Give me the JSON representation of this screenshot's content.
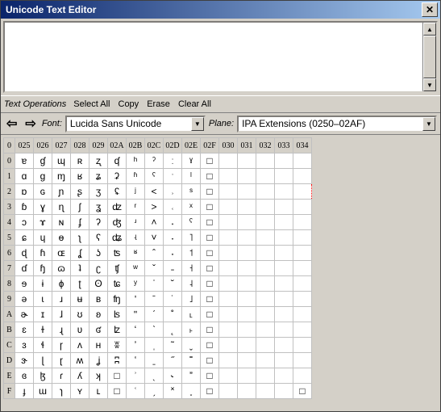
{
  "window": {
    "title": "Unicode Text Editor"
  },
  "ops": {
    "label": "Text Operations",
    "select_all": "Select All",
    "copy": "Copy",
    "erase": "Erase",
    "clear_all": "Clear All"
  },
  "nav": {
    "prev_glyph": "⇦",
    "next_glyph": "⇨",
    "font_label": "Font:",
    "font_value": "Lucida Sans Unicode",
    "plane_label": "Plane:",
    "plane_value": "IPA Extensions (0250–02AF)"
  },
  "grid": {
    "col_headers": [
      "025",
      "026",
      "027",
      "028",
      "029",
      "02A",
      "02B",
      "02C",
      "02D",
      "02E",
      "02F",
      "030",
      "031",
      "032",
      "033",
      "034"
    ],
    "row_headers": [
      "0",
      "1",
      "2",
      "3",
      "4",
      "5",
      "6",
      "7",
      "8",
      "9",
      "A",
      "B",
      "C",
      "D",
      "E",
      "F"
    ],
    "selected": {
      "row": 2,
      "col": 15
    },
    "rows": [
      [
        "ɐ",
        "ɠ",
        "ɰ",
        "ʀ",
        "ʐ",
        "ʠ",
        "ʰ",
        "ˀ",
        "ː",
        "ˠ",
        "□",
        "",
        "",
        "",
        "",
        ""
      ],
      [
        "ɑ",
        "ɡ",
        "ɱ",
        "ʁ",
        "ʑ",
        "ʡ",
        "ʱ",
        "ˁ",
        "ˑ",
        "ˡ",
        "□",
        "",
        "",
        "",
        "",
        ""
      ],
      [
        "ɒ",
        "ɢ",
        "ɲ",
        "ʂ",
        "ʒ",
        "ʢ",
        "ʲ",
        "˂",
        "˒",
        "ˢ",
        "□",
        "",
        "",
        "",
        "",
        ""
      ],
      [
        "ɓ",
        "ɣ",
        "ɳ",
        "ʃ",
        "ʓ",
        "ʣ",
        "ʳ",
        "˃",
        "˓",
        "ˣ",
        "□",
        "",
        "",
        "",
        "",
        ""
      ],
      [
        "ɔ",
        "ɤ",
        "ɴ",
        "ʄ",
        "ʔ",
        "ʤ",
        "ʴ",
        "˄",
        "˔",
        "ˤ",
        "□",
        "",
        "",
        "",
        "",
        ""
      ],
      [
        "ɕ",
        "ɥ",
        "ɵ",
        "ʅ",
        "ʕ",
        "ʥ",
        "ʵ",
        "˅",
        "˕",
        "˥",
        "□",
        "",
        "",
        "",
        "",
        ""
      ],
      [
        "ɖ",
        "ɦ",
        "ɶ",
        "ʆ",
        "ʖ",
        "ʦ",
        "ʶ",
        "ˆ",
        "˖",
        "˦",
        "□",
        "",
        "",
        "",
        "",
        ""
      ],
      [
        "ɗ",
        "ɧ",
        "ɷ",
        "ʇ",
        "ʗ",
        "ʧ",
        "ʷ",
        "ˇ",
        "˗",
        "˧",
        "□",
        "",
        "",
        "",
        "",
        ""
      ],
      [
        "ɘ",
        "ɨ",
        "ɸ",
        "ʈ",
        "ʘ",
        "ʨ",
        "ʸ",
        "ˈ",
        "˘",
        "˨",
        "□",
        "",
        "",
        "",
        "",
        ""
      ],
      [
        "ə",
        "ɩ",
        "ɹ",
        "ʉ",
        "ʙ",
        "ʩ",
        "ʹ",
        "ˉ",
        "˙",
        "˩",
        "□",
        "",
        "",
        "",
        "",
        ""
      ],
      [
        "ɚ",
        "ɪ",
        "ɺ",
        "ʊ",
        "ʚ",
        "ʪ",
        "ʺ",
        "ˊ",
        "˚",
        "˪",
        "□",
        "",
        "",
        "",
        "",
        ""
      ],
      [
        "ɛ",
        "ɫ",
        "ɻ",
        "ʋ",
        "ʛ",
        "ʫ",
        "ʻ",
        "ˋ",
        "˛",
        "˫",
        "□",
        "",
        "",
        "",
        "",
        ""
      ],
      [
        "ɜ",
        "ɬ",
        "ɼ",
        "ʌ",
        "ʜ",
        "ʬ",
        "ʼ",
        "ˌ",
        "˜",
        "ˬ",
        "□",
        "",
        "",
        "",
        "",
        ""
      ],
      [
        "ɝ",
        "ɭ",
        "ɽ",
        "ʍ",
        "ʝ",
        "ʭ",
        "ʽ",
        "ˍ",
        "˝",
        "˭",
        "□",
        "",
        "",
        "",
        "",
        ""
      ],
      [
        "ɞ",
        "ɮ",
        "ɾ",
        "ʎ",
        "ʞ",
        "□",
        "ʾ",
        "ˎ",
        "˞",
        "ˮ",
        "□",
        "",
        "",
        "",
        "",
        ""
      ],
      [
        "ɟ",
        "ɯ",
        "ɿ",
        "ʏ",
        "ʟ",
        "□",
        "ʿ",
        "ˏ",
        "˟",
        "˯",
        "□",
        "",
        "",
        "",
        "",
        "□"
      ]
    ]
  }
}
